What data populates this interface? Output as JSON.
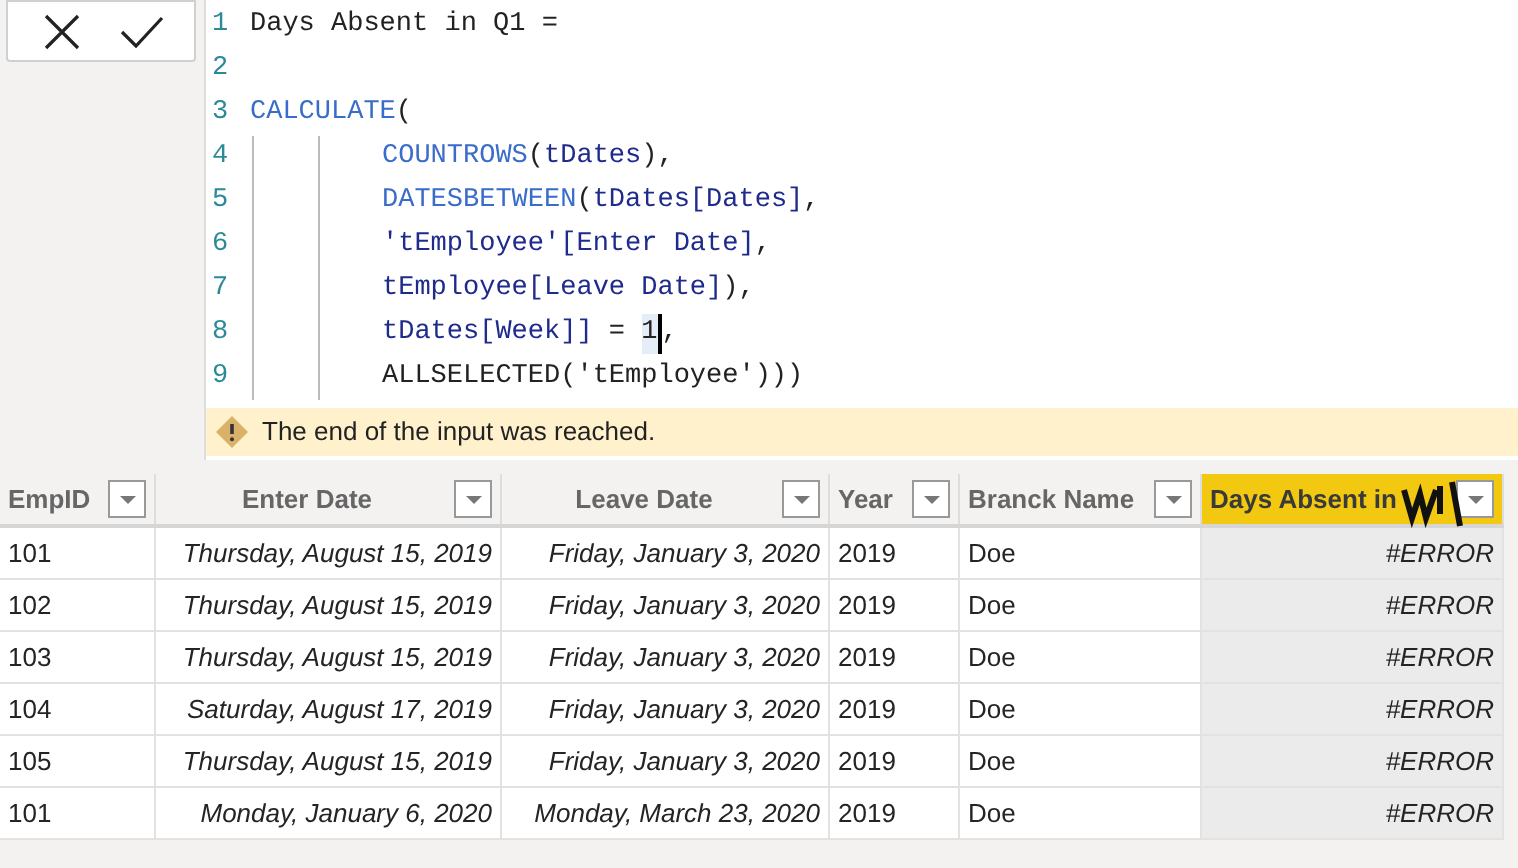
{
  "formula_bar": {
    "buttons": [
      {
        "kind": "cancel"
      },
      {
        "kind": "commit"
      }
    ],
    "lines": [
      {
        "number": "1",
        "segments": [
          {
            "kind": "plain",
            "text": "Days Absent in Q1 ="
          }
        ]
      },
      {
        "number": "2"
      },
      {
        "number": "3",
        "segments": [
          {
            "kind": "fn",
            "text": "CALCULATE"
          },
          {
            "kind": "plain",
            "text": "("
          }
        ],
        "children": [
          {
            "number": "4",
            "segments": [
              {
                "kind": "fn",
                "text": "COUNTROWS"
              },
              {
                "kind": "plain",
                "text": "("
              },
              {
                "kind": "ref",
                "text": "tDates"
              },
              {
                "kind": "plain",
                "text": "),"
              }
            ]
          },
          {
            "number": "5",
            "segments": [
              {
                "kind": "fn",
                "text": "DATESBETWEEN"
              },
              {
                "kind": "plain",
                "text": "("
              },
              {
                "kind": "ref",
                "text": "tDates[Dates]"
              },
              {
                "kind": "plain",
                "text": ","
              }
            ]
          },
          {
            "number": "6",
            "segments": [
              {
                "kind": "ref",
                "text": "'tEmployee'[Enter Date]"
              },
              {
                "kind": "plain",
                "text": ","
              }
            ]
          },
          {
            "number": "7",
            "segments": [
              {
                "kind": "ref",
                "text": "tEmployee[Leave Date]"
              },
              {
                "kind": "plain",
                "text": "),"
              }
            ]
          },
          {
            "number": "8",
            "segments": [
              {
                "kind": "ref",
                "text": "tDates[Week]]"
              },
              {
                "kind": "plain",
                "text": " = "
              },
              {
                "kind": "plain",
                "text": "1",
                "caret_after": true
              },
              {
                "kind": "plain",
                "text": ","
              }
            ]
          },
          {
            "number": "9",
            "segments": [
              {
                "kind": "plain",
                "text": "ALLSELECTED('tEmployee')))"
              }
            ]
          }
        ]
      }
    ],
    "warning": "The end of the input was reached."
  },
  "table": {
    "columns": [
      {
        "label": "EmpID",
        "kind": "text",
        "selected": false
      },
      {
        "label": "Enter Date",
        "kind": "date",
        "selected": false
      },
      {
        "label": "Leave Date",
        "kind": "date",
        "selected": false
      },
      {
        "label": "Year",
        "kind": "text",
        "selected": false
      },
      {
        "label": "Branck Name",
        "kind": "text",
        "selected": false
      },
      {
        "label": "Days Absent in",
        "kind": "measure",
        "selected": true
      }
    ],
    "rows": [
      [
        "101",
        "Thursday, August 15, 2019",
        "Friday, January 3, 2020",
        "2019",
        "Doe",
        "#ERROR"
      ],
      [
        "102",
        "Thursday, August 15, 2019",
        "Friday, January 3, 2020",
        "2019",
        "Doe",
        "#ERROR"
      ],
      [
        "103",
        "Thursday, August 15, 2019",
        "Friday, January 3, 2020",
        "2019",
        "Doe",
        "#ERROR"
      ],
      [
        "104",
        "Saturday, August 17, 2019",
        "Friday, January 3, 2020",
        "2019",
        "Doe",
        "#ERROR"
      ],
      [
        "105",
        "Thursday, August 15, 2019",
        "Friday, January 3, 2020",
        "2019",
        "Doe",
        "#ERROR"
      ],
      [
        "101",
        "Monday, January 6, 2020",
        "Monday, March 23, 2020",
        "2019",
        "Doe",
        "#ERROR"
      ]
    ]
  }
}
